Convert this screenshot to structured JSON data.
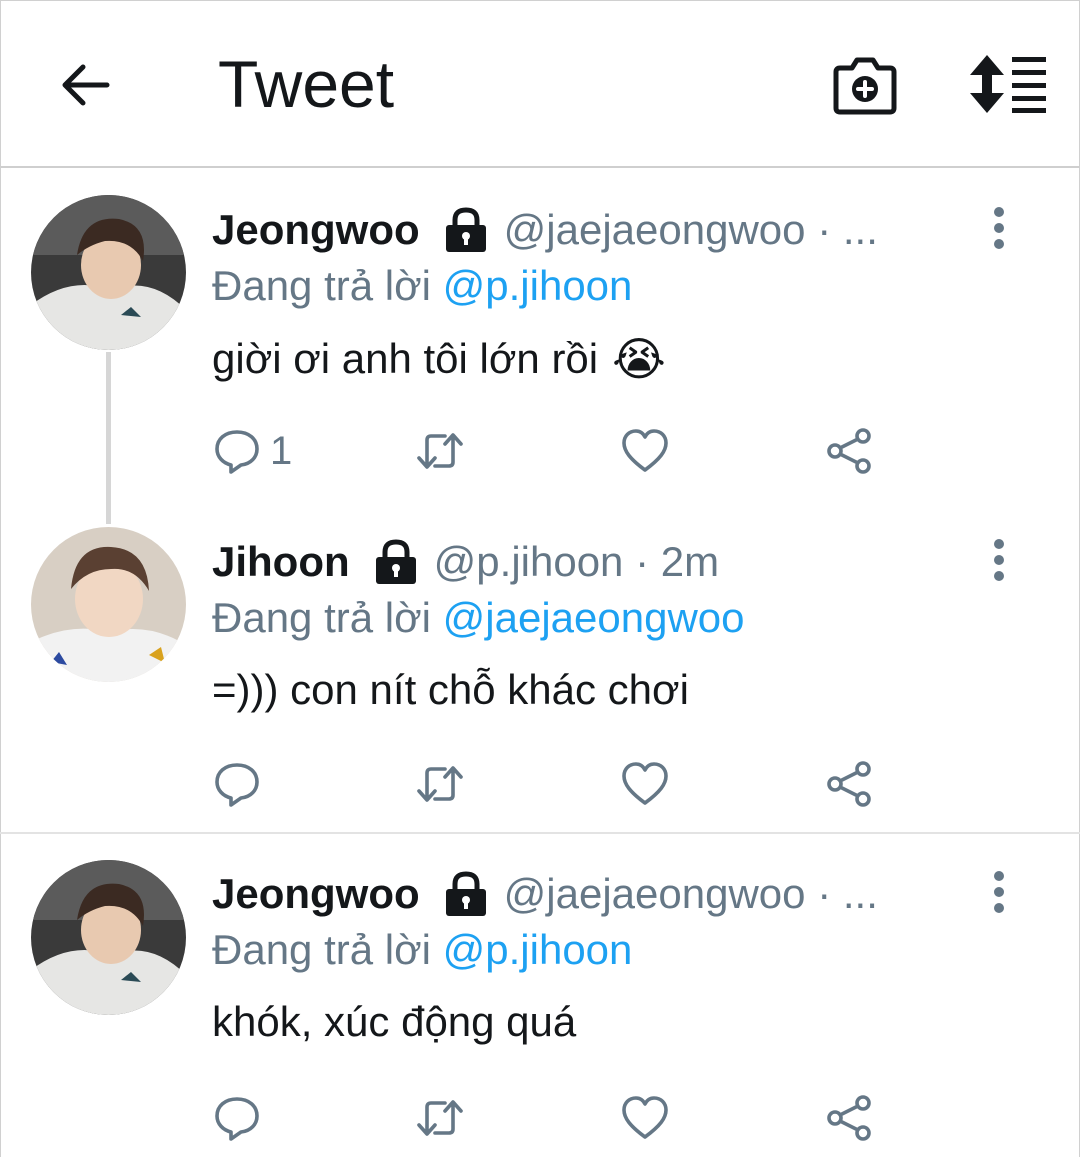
{
  "header": {
    "title": "Tweet"
  },
  "icons": {
    "back": "arrow-left-icon",
    "camera": "camera-plus-icon",
    "sort": "sort-icon",
    "lock": "lock-icon",
    "more": "more-vertical-icon",
    "reply": "reply-icon",
    "retweet": "retweet-icon",
    "like": "heart-icon",
    "share": "share-icon"
  },
  "colors": {
    "mention": "#1da1f2",
    "secondary_text": "#657786",
    "primary_text": "#14171a"
  },
  "tweets": [
    {
      "name": "Jeongwoo",
      "handle": "@jaejaeongwoo · ...",
      "reply_prefix": "Đang trả lời ",
      "reply_to": "@p.jihoon",
      "text": "giời ơi anh tôi lớn rồi",
      "emoji": "😭",
      "reply_count": "1"
    },
    {
      "name": "Jihoon",
      "handle": "@p.jihoon · 2m",
      "reply_prefix": "Đang trả lời ",
      "reply_to": "@jaejaeongwoo",
      "text": "=))) con nít chỗ khác chơi",
      "reply_count": ""
    },
    {
      "name": "Jeongwoo",
      "handle": "@jaejaeongwoo · ...",
      "reply_prefix": "Đang trả lời ",
      "reply_to": "@p.jihoon",
      "text": "khók, xúc động quá",
      "reply_count": ""
    }
  ]
}
